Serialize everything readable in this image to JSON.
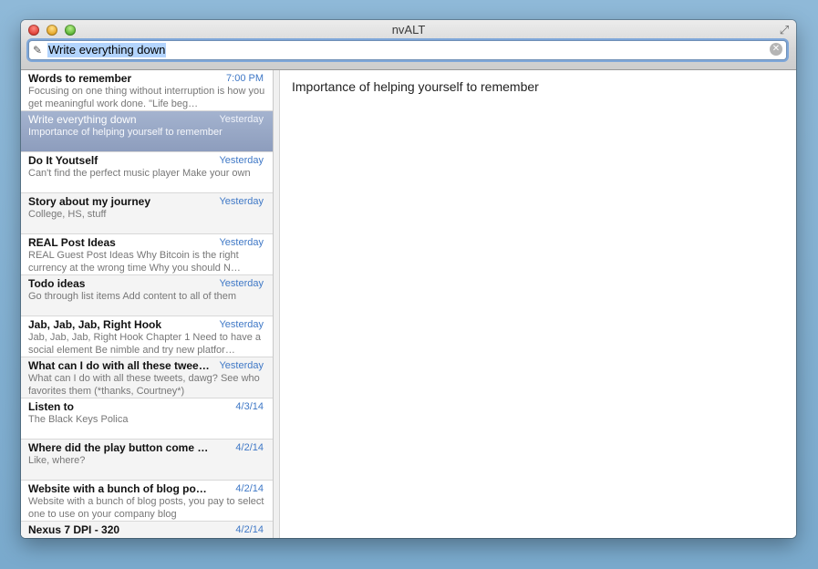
{
  "window": {
    "title": "nvALT"
  },
  "search": {
    "value": "Write everything down"
  },
  "notes": [
    {
      "title": "Words to remember",
      "date": "7:00 PM",
      "preview": "Focusing on one thing without interruption is how you get meaningful work done.  \"Life beg…"
    },
    {
      "title": "Write everything down",
      "date": "Yesterday",
      "preview": "Importance of helping yourself to remember",
      "selected": true
    },
    {
      "title": "Do It Youtself",
      "date": "Yesterday",
      "preview": "Can't find the perfect music player  Make your own"
    },
    {
      "title": "Story about my journey",
      "date": "Yesterday",
      "preview": "College, HS, stuff"
    },
    {
      "title": "REAL Post Ideas",
      "date": "Yesterday",
      "preview": "REAL Guest Post Ideas Why Bitcoin is the right currency at the wrong time Why you should N…"
    },
    {
      "title": "Todo ideas",
      "date": "Yesterday",
      "preview": "Go through list items Add content to all of them"
    },
    {
      "title": "Jab, Jab, Jab, Right Hook",
      "date": "Yesterday",
      "preview": "Jab, Jab, Jab, Right Hook Chapter 1 Need to have a social element Be nimble and try new platfor…"
    },
    {
      "title": "What can I do with all these tweet…",
      "date": "Yesterday",
      "preview": "What can I do with all these tweets, dawg? See who favorites them (*thanks, Courtney*)"
    },
    {
      "title": "Listen to",
      "date": "4/3/14",
      "preview": "The Black Keys Polica"
    },
    {
      "title": "Where did the play button come fr…",
      "date": "4/2/14",
      "preview": "Like, where?"
    },
    {
      "title": "Website with a bunch of blog post…",
      "date": "4/2/14",
      "preview": "Website with a bunch of blog posts, you pay to select one to use on your company blog"
    },
    {
      "title": "Nexus 7 DPI - 320",
      "date": "4/2/14",
      "preview": ""
    }
  ],
  "editor": {
    "content": "Importance of helping yourself to remember"
  },
  "colors": {
    "date": "#3f78c6",
    "selection": "#8d9dbd",
    "search_highlight": "#b3d4fd"
  }
}
